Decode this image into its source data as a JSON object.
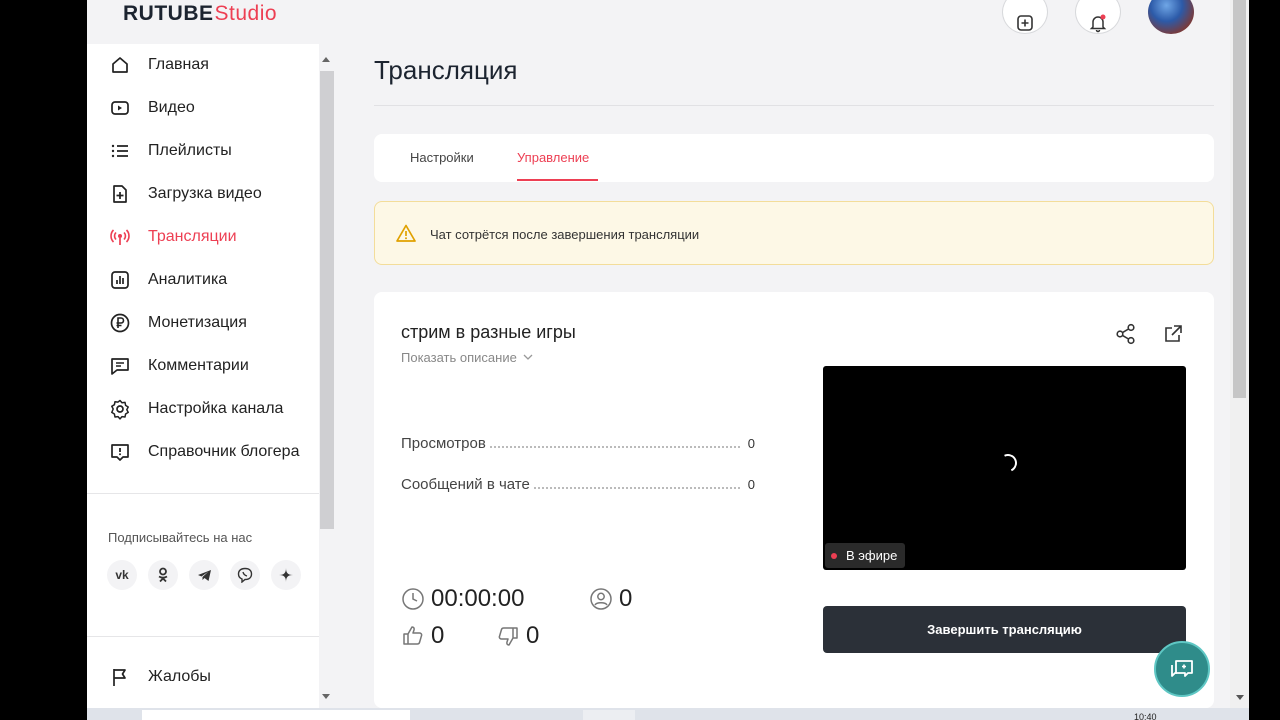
{
  "header": {
    "logo_main": "RUTUBE",
    "logo_studio": "Studio"
  },
  "sidebar": {
    "items": [
      {
        "label": "Главная",
        "icon": "home-icon"
      },
      {
        "label": "Видео",
        "icon": "video-icon"
      },
      {
        "label": "Плейлисты",
        "icon": "playlist-icon"
      },
      {
        "label": "Загрузка видео",
        "icon": "upload-icon"
      },
      {
        "label": "Трансляции",
        "icon": "broadcast-icon",
        "active": true
      },
      {
        "label": "Аналитика",
        "icon": "analytics-icon"
      },
      {
        "label": "Монетизация",
        "icon": "ruble-icon"
      },
      {
        "label": "Комментарии",
        "icon": "comment-icon"
      },
      {
        "label": "Настройка канала",
        "icon": "gear-icon"
      },
      {
        "label": "Справочник блогера",
        "icon": "info-icon"
      }
    ],
    "social_title": "Подписывайтесь на нас",
    "social": [
      "vk",
      "ok",
      "telegram",
      "viber",
      "zen"
    ],
    "vk_label": "vk",
    "complaints": "Жалобы"
  },
  "main": {
    "title": "Трансляция",
    "tabs": [
      {
        "label": "Настройки"
      },
      {
        "label": "Управление",
        "active": true
      }
    ],
    "warning": "Чат сотрётся после завершения трансляции",
    "stream": {
      "title": "стрим в разные игры",
      "show_description": "Показать описание",
      "stats": [
        {
          "label": "Просмотров",
          "value": "0"
        },
        {
          "label": "Сообщений в чате",
          "value": "0"
        }
      ],
      "live_badge": "В эфире",
      "end_button": "Завершить трансляцию",
      "duration": "00:00:00",
      "viewers": "0",
      "likes": "0",
      "dislikes": "0"
    }
  },
  "taskbar": {
    "clock": "10:40"
  },
  "colors": {
    "accent": "#ed3f53",
    "dark_button": "#2b3038",
    "help_button": "#2f8c8a",
    "warning_bg": "#fdf8e6"
  }
}
